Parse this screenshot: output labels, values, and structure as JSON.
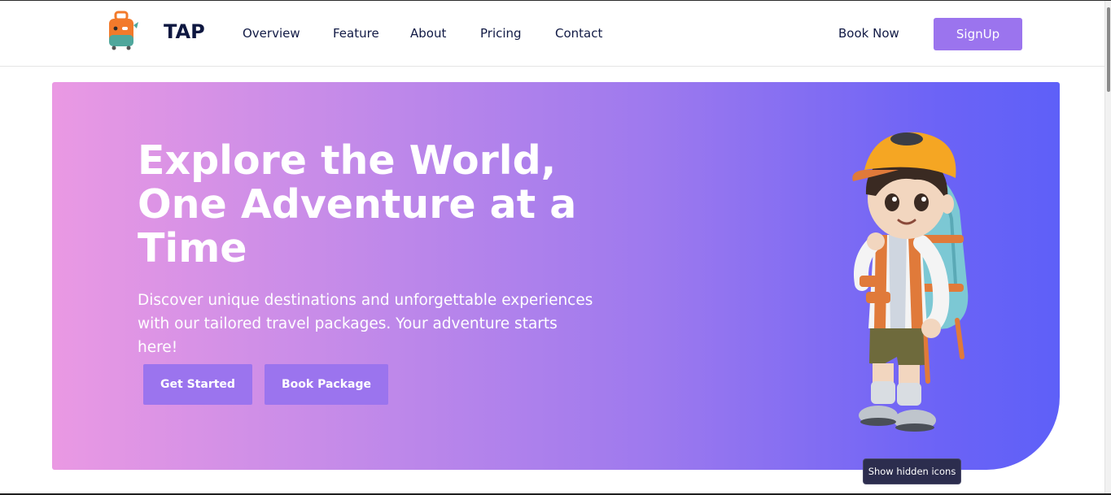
{
  "brand": {
    "name": "TAP",
    "icon": "suitcase-logo-icon"
  },
  "nav": {
    "links": [
      "Overview",
      "Feature",
      "About",
      "Pricing",
      "Contact"
    ],
    "book_now": "Book Now",
    "signup": "SignUp"
  },
  "hero": {
    "title_lines": [
      "Explore the World,",
      "One Adventure at a",
      "Time"
    ],
    "subtitle_lines": [
      "Discover unique destinations and unforgettable experiences",
      "with our tailored travel packages. Your adventure starts here!"
    ],
    "buttons": {
      "get_started": "Get Started",
      "book_package": "Book Package"
    },
    "illustration": "backpacker-boy-illustration"
  },
  "tooltip": "Show hidden icons",
  "colors": {
    "accent": "#9b74ee",
    "nav_text": "#111a45",
    "gradient_start": "#ea99e3",
    "gradient_end": "#5e60f8"
  }
}
